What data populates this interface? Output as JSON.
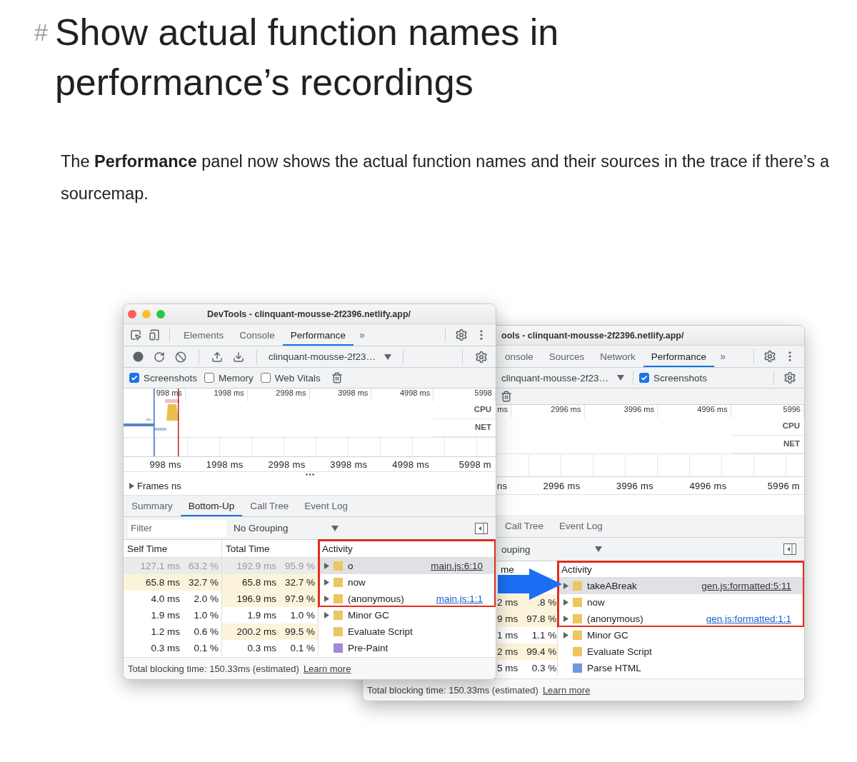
{
  "article": {
    "anchor": "#",
    "heading": "Show actual function names in performance’s recordings",
    "paragraph": "The **Performance** panel now shows the actual function names and their sources in the trace if there’s a sourcemap."
  },
  "windows": [
    {
      "kind": "front",
      "title": "DevTools - clinquant-mousse-2f2396.netlify.app/",
      "tabs": [
        {
          "label": "Elements",
          "selected": false
        },
        {
          "label": "Console",
          "selected": false
        },
        {
          "label": "Performance",
          "selected": true
        }
      ],
      "overflow": "»",
      "target": "clinquant-mousse-2f23…",
      "options": [
        {
          "label": "Screenshots",
          "checked": true
        },
        {
          "label": "Memory",
          "checked": false
        },
        {
          "label": "Web Vitals",
          "checked": false
        }
      ],
      "top_ticks": [
        "998 ms",
        "1998 ms",
        "2998 ms",
        "3998 ms",
        "4998 ms",
        "5998"
      ],
      "tracks": [
        "CPU",
        "NET"
      ],
      "bottom_ticks": [
        "998 ms",
        "1998 ms",
        "2998 ms",
        "3998 ms",
        "4998 ms",
        "5998 m"
      ],
      "frames": {
        "label": "Frames",
        "trailing": "ns"
      },
      "panel_tabs": [
        {
          "label": "Summary",
          "selected": false
        },
        {
          "label": "Bottom-Up",
          "selected": true
        },
        {
          "label": "Call Tree",
          "selected": false
        },
        {
          "label": "Event Log",
          "selected": false
        }
      ],
      "filter_placeholder": "Filter",
      "grouping": "No Grouping",
      "columns": [
        "Self Time",
        "Total Time",
        "Activity"
      ],
      "rows": [
        {
          "times": [
            {
              "ms": "127.1 ms",
              "pct": "63.2 %",
              "highlight": false
            },
            {
              "ms": "192.9 ms",
              "pct": "95.9 %",
              "highlight": false
            }
          ],
          "name": "o",
          "color": "#ecc65e",
          "expandable": true,
          "source": "main.js:6:10",
          "selected": true,
          "boxed": true
        },
        {
          "times": [
            {
              "ms": "65.8 ms",
              "pct": "32.7 %",
              "highlight": true
            },
            {
              "ms": "65.8 ms",
              "pct": "32.7 %",
              "highlight": true
            }
          ],
          "name": "now",
          "color": "#ecc65e",
          "expandable": true,
          "selected": false,
          "boxed": true
        },
        {
          "times": [
            {
              "ms": "4.0 ms",
              "pct": "2.0 %",
              "highlight": false
            },
            {
              "ms": "196.9 ms",
              "pct": "97.9 %",
              "highlight": true
            }
          ],
          "name": "(anonymous)",
          "color": "#ecc65e",
          "expandable": true,
          "source": "main.js:1:1",
          "selected": false,
          "boxed": true
        },
        {
          "times": [
            {
              "ms": "1.9 ms",
              "pct": "1.0 %",
              "highlight": false
            },
            {
              "ms": "1.9 ms",
              "pct": "1.0 %",
              "highlight": false
            }
          ],
          "name": "Minor GC",
          "color": "#ecc65e",
          "expandable": true,
          "selected": false,
          "boxed": false
        },
        {
          "times": [
            {
              "ms": "1.2 ms",
              "pct": "0.6 %",
              "highlight": false
            },
            {
              "ms": "200.2 ms",
              "pct": "99.5 %",
              "highlight": true
            }
          ],
          "name": "Evaluate Script",
          "color": "#ecc65e",
          "expandable": false,
          "selected": false,
          "boxed": false
        },
        {
          "times": [
            {
              "ms": "0.3 ms",
              "pct": "0.1 %",
              "highlight": false
            },
            {
              "ms": "0.3 ms",
              "pct": "0.1 %",
              "highlight": false
            }
          ],
          "name": "Pre-Paint",
          "color": "#a08ad8",
          "expandable": false,
          "selected": false,
          "boxed": false
        }
      ],
      "footer": {
        "text": "Total blocking time: 150.33ms (estimated)",
        "link": "Learn more"
      }
    },
    {
      "kind": "back",
      "title": "ools - clinquant-mousse-2f2396.netlify.app/",
      "tabs": [
        {
          "label": "onsole",
          "selected": false
        },
        {
          "label": "Sources",
          "selected": false
        },
        {
          "label": "Network",
          "selected": false
        },
        {
          "label": "Performance",
          "selected": true
        }
      ],
      "overflow": "»",
      "target": "clinquant-mousse-2f23…",
      "options": [
        {
          "label": "Screenshots",
          "checked": true
        }
      ],
      "top_ticks": [
        "ms",
        "2996 ms",
        "3996 ms",
        "4996 ms",
        "5996"
      ],
      "tracks": [
        "CPU",
        "NET"
      ],
      "bottom_ticks": [
        "ns",
        "2996 ms",
        "3996 ms",
        "4996 ms",
        "5996 m"
      ],
      "panel_tabs": [
        {
          "label": "Call Tree",
          "selected": false
        },
        {
          "label": "Event Log",
          "selected": false
        }
      ],
      "grouping": "ouping",
      "columns": [
        "me",
        "Activity"
      ],
      "rows": [
        {
          "name": "takeABreak",
          "color": "#ecc65e",
          "expandable": true,
          "source": "gen.js:formatted:5:11",
          "selected": true,
          "boxed": true
        },
        {
          "times": [
            {
              "ms": "2 ms",
              "pct": ".8 %",
              "highlight": true
            }
          ],
          "name": "now",
          "color": "#ecc65e",
          "expandable": true,
          "selected": false,
          "boxed": true
        },
        {
          "times": [
            {
              "ms": "9 ms",
              "pct": "97.8 %",
              "highlight": true
            }
          ],
          "name": "(anonymous)",
          "color": "#ecc65e",
          "expandable": true,
          "source": "gen.js:formatted:1:1",
          "selected": false,
          "boxed": true
        },
        {
          "times": [
            {
              "ms": "1 ms",
              "pct": "1.1 %",
              "highlight": false
            }
          ],
          "name": "Minor GC",
          "color": "#ecc65e",
          "expandable": true,
          "selected": false,
          "boxed": false
        },
        {
          "times": [
            {
              "ms": "2 ms",
              "pct": "99.4 %",
              "highlight": true
            }
          ],
          "name": "Evaluate Script",
          "color": "#ecc65e",
          "expandable": false,
          "selected": false,
          "boxed": false
        },
        {
          "times": [
            {
              "ms": "5 ms",
              "pct": "0.3 %",
              "highlight": false
            }
          ],
          "name": "Parse HTML",
          "color": "#6f97e2",
          "expandable": false,
          "selected": false,
          "boxed": false
        }
      ],
      "footer": {
        "text": "Total blocking time: 150.33ms (estimated)",
        "link": "Learn more"
      }
    }
  ]
}
